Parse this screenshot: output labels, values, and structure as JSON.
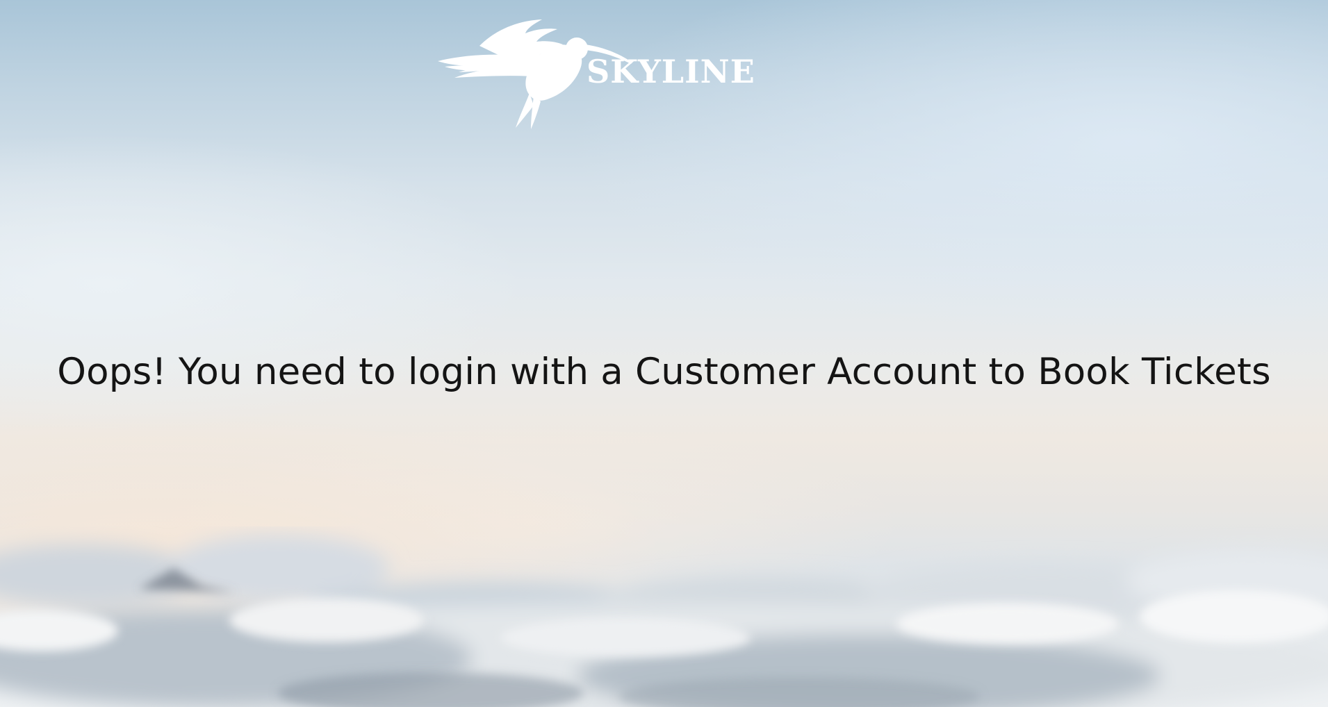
{
  "brand": {
    "name": "SKYLINE",
    "logo_icon": "hummingbird-icon"
  },
  "message": {
    "text": "Oops! You need to login with a Customer Account to Book Tickets"
  },
  "colors": {
    "text": "#141414",
    "logo": "#ffffff",
    "sky_top": "#a9c5d8",
    "horizon": "#efe9e2"
  }
}
